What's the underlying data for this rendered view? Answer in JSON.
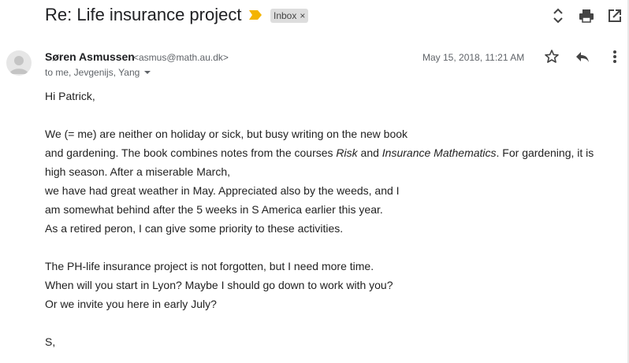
{
  "email": {
    "subject": "Re: Life insurance project",
    "label": "Inbox",
    "label_remove": "×",
    "sender_name": "Søren Asmussen",
    "sender_email": "<asmus@math.au.dk>",
    "recipients": "to me, Jevgenijs, Yang",
    "date": "May 15, 2018, 11:21 AM"
  },
  "body": {
    "greeting": "Hi Patrick,",
    "p1_l1": "We (= me)  are neither on holiday or sick, but busy writing on the new book",
    "p1_l2_a": "and gardening. The book combines notes from the courses ",
    "p1_l2_risk": "Risk",
    "p1_l2_and": " and ",
    "p1_l2_im": "Insurance Mathematics",
    "p1_l2_b": ". For gardening, it is high season. After a miserable March,",
    "p1_l3": "we have had great weather in May. Appreciated also by the weeds, and I",
    "p1_l4": "am somewhat behind after the 5 weeks in S America earlier this year.",
    "p1_l5": "As a retired peron, I can give some priority to these activities.",
    "p2_l1": "The PH-life insurance project is not forgotten, but I need more time.",
    "p2_l2": "When will you start in Lyon? Maybe I should go down to work with you?",
    "p2_l3": "Or we invite you here in early July?",
    "signoff": "S,"
  },
  "icons": {
    "importance": "importance-marker-icon",
    "expand": "expand-collapse-icon",
    "print": "print-icon",
    "open_new_window": "open-in-new-window-icon",
    "star": "star-icon",
    "reply": "reply-icon",
    "more": "more-vert-icon",
    "avatar": "avatar-icon",
    "recipients_caret": "caret-down-icon"
  },
  "colors": {
    "importance": "#f4b400",
    "chip_bg": "#dddddd",
    "text": "#222222",
    "muted": "#5f6368"
  }
}
